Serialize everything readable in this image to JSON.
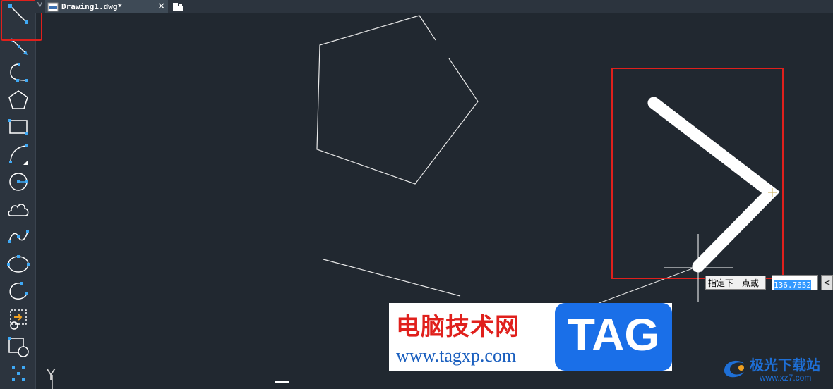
{
  "tabs": {
    "prev_indicator": "V",
    "active_title": "Drawing1.dwg*",
    "close_glyph": "✕"
  },
  "toolbar": {
    "tools": [
      {
        "name": "line",
        "icon": "line-icon"
      },
      {
        "name": "ray",
        "icon": "ray-icon"
      },
      {
        "name": "polyline",
        "icon": "polyline-icon"
      },
      {
        "name": "polygon",
        "icon": "polygon-icon"
      },
      {
        "name": "rectangle",
        "icon": "rectangle-icon"
      },
      {
        "name": "arc",
        "icon": "arc-icon"
      },
      {
        "name": "circle",
        "icon": "circle-icon"
      },
      {
        "name": "revision-cloud",
        "icon": "cloud-icon"
      },
      {
        "name": "spline",
        "icon": "spline-icon"
      },
      {
        "name": "ellipse",
        "icon": "ellipse-icon"
      },
      {
        "name": "ellipse-arc",
        "icon": "ellipse-arc-icon"
      },
      {
        "name": "insert-block",
        "icon": "insert-block-icon"
      },
      {
        "name": "make-block",
        "icon": "make-block-icon"
      },
      {
        "name": "point",
        "icon": "point-icon"
      }
    ],
    "active_tool": "line"
  },
  "command": {
    "prompt": "指定下一点或",
    "value": "136.7652",
    "options_glyph": "<"
  },
  "ucs": {
    "y_label": "Y"
  },
  "watermark": {
    "title": "电脑技术网",
    "url": "www.tagxp.com",
    "tag": "TAG"
  },
  "corner_logo": {
    "text": "极光下载站",
    "url": "www.xz7.com"
  },
  "colors": {
    "canvas_bg": "#212830",
    "toolbar_bg": "#2c343e",
    "icon_blue": "#3fa9f5",
    "highlight_red": "#e0201c",
    "entity_white": "#ffffff"
  }
}
